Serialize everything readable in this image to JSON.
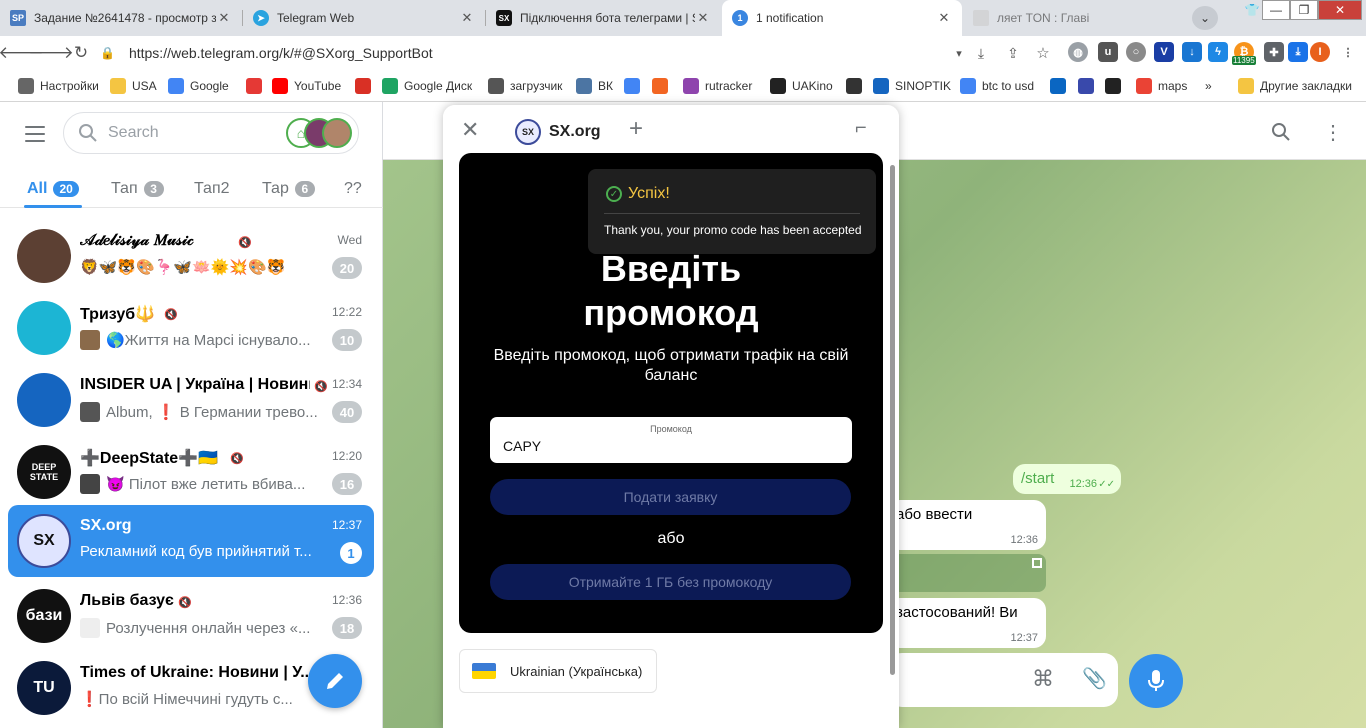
{
  "browser": {
    "tabs": [
      {
        "label": "Задание №2641478 - просмотр з",
        "icon_text": "SP",
        "icon_color": "#4a7cc0"
      },
      {
        "label": "Telegram Web",
        "icon_text": "",
        "icon_color": "#2aa3df"
      },
      {
        "label": "Підключення бота телеграми | SX",
        "icon_text": "SX",
        "icon_color": "#111111"
      },
      {
        "label": "1 notification",
        "icon_text": "1",
        "icon_color": "#3a86e0"
      },
      {
        "label": "",
        "icon_text": "",
        "icon_color": "#cccccc"
      },
      {
        "label": "ляет TON : Главі",
        "icon_text": "",
        "icon_color": "#cccccc"
      }
    ],
    "url": "https://web.telegram.org/k/#@SXorg_SupportBot",
    "extension_badge": "11395",
    "profile_initial": "I",
    "bookmarks": [
      {
        "label": "Настройки",
        "icon": "gear-icon",
        "color": "#666666"
      },
      {
        "label": "USA",
        "icon": "folder-icon",
        "color": "#f4c542"
      },
      {
        "label": "Google",
        "icon": "google-icon",
        "color": "#4285f4"
      },
      {
        "label": "",
        "icon": "yandex-icon",
        "color": "#e53935"
      },
      {
        "label": "YouTube",
        "icon": "youtube-icon",
        "color": "#ff0000"
      },
      {
        "label": "",
        "icon": "gmail-icon",
        "color": "#d93025"
      },
      {
        "label": "Google Диск",
        "icon": "drive-icon",
        "color": "#1fa463"
      },
      {
        "label": "загрузчик",
        "icon": "globe-icon",
        "color": "#555555"
      },
      {
        "label": "ВК",
        "icon": "vk-icon",
        "color": "#4c75a3"
      },
      {
        "label": "",
        "icon": "translate-icon",
        "color": "#4285f4"
      },
      {
        "label": "",
        "icon": "f-icon",
        "color": "#f26522"
      },
      {
        "label": "rutracker",
        "icon": "rutracker-icon",
        "color": "#8e44ad"
      },
      {
        "label": "UAKino",
        "icon": "uakino-icon",
        "color": "#222222"
      },
      {
        "label": "",
        "icon": "chess-icon",
        "color": "#333333"
      },
      {
        "label": "SINOPTIK",
        "icon": "thermometer-icon",
        "color": "#1565c0"
      },
      {
        "label": "btc to usd",
        "icon": "google-icon",
        "color": "#4285f4"
      },
      {
        "label": "",
        "icon": "p-icon",
        "color": "#0a66c2"
      },
      {
        "label": "",
        "icon": "arrow-icon",
        "color": "#3949ab"
      },
      {
        "label": "",
        "icon": "bc-icon",
        "color": "#222222"
      },
      {
        "label": "maps",
        "icon": "maps-icon",
        "color": "#ea4335"
      }
    ],
    "other_bookmarks": "Другие закладки",
    "more": "»"
  },
  "sidebar": {
    "search_placeholder": "Search",
    "folders": [
      {
        "label": "All",
        "count": "20"
      },
      {
        "label": "Тап",
        "count": "3"
      },
      {
        "label": "Тап2",
        "count": ""
      },
      {
        "label": "Тар",
        "count": "6"
      },
      {
        "label": "??",
        "count": ""
      }
    ],
    "chats": [
      {
        "title": "𝒜𝒹𝑒𝓁𝒾𝓈𝒾𝓎𝒶 𝑀𝓊𝓈𝒾𝒸",
        "time": "Wed",
        "message": "🦁🦋🐯🎨🦩🦋🪷🌞💥🎨🐯",
        "badge": "20",
        "avatar_color": "#5c4033",
        "avatar_text": "",
        "thumb": ""
      },
      {
        "title": "Тризуб🔱",
        "time": "12:22",
        "message": "🌎Життя на Марсі існувало...",
        "badge": "10",
        "avatar_color": "#1cb5d4",
        "avatar_text": "",
        "thumb": "#8a6a4a"
      },
      {
        "title": "INSIDER UA | Україна | Новини",
        "time": "12:34",
        "message": "Album, ❗ В Германии трево...",
        "badge": "40",
        "avatar_color": "#1565c0",
        "avatar_text": "",
        "thumb": "#555555"
      },
      {
        "title": "➕DeepState➕🇺🇦",
        "time": "12:20",
        "message": "😈 Пілот вже летить вбива...",
        "badge": "16",
        "avatar_color": "#111111",
        "avatar_text": "DEEP STATE",
        "thumb": "#444444"
      },
      {
        "title": "SX.org",
        "time": "12:37",
        "message": "Рекламний код був прийнятий т...",
        "badge": "1",
        "avatar_color": "#dfe4ff",
        "avatar_text": "SX",
        "thumb": ""
      },
      {
        "title": "Львів базує",
        "time": "12:36",
        "message": "Розлучення онлайн через «...",
        "badge": "18",
        "avatar_color": "#111111",
        "avatar_text": "бази",
        "thumb": "#eeeeee"
      },
      {
        "title": "Times of Ukraine: Новини | У...",
        "time": "",
        "message": "❗По всій Німеччині гудуть с...",
        "badge": "",
        "avatar_color": "#0b1a3a",
        "avatar_text": "TU",
        "thumb": ""
      }
    ]
  },
  "conversation": {
    "outgoing": {
      "text": "/start",
      "time": "12:36"
    },
    "incoming": [
      {
        "text": "або ввести",
        "time": "12:36"
      },
      {
        "text": "застосований! Ви",
        "time": "12:37"
      }
    ]
  },
  "webapp": {
    "tab_title": "SX.org",
    "toast_title": "Успіх!",
    "toast_message": "Thank you, your promo code has been accepted",
    "heading": "Введіть промокод",
    "subtitle": "Введіть промокод, щоб отримати трафік на свій баланс",
    "promo_label": "Промокод",
    "promo_value": "CAPY",
    "submit_label": "Подати заявку",
    "or_label": "або",
    "free_label": "Отримайте 1 ГБ без промокоду",
    "language_label": "Ukrainian (Українська)"
  },
  "colors": {
    "accent": "#3390ec",
    "dark_button": "#0c1a55",
    "toast_title": "#f4c542"
  }
}
